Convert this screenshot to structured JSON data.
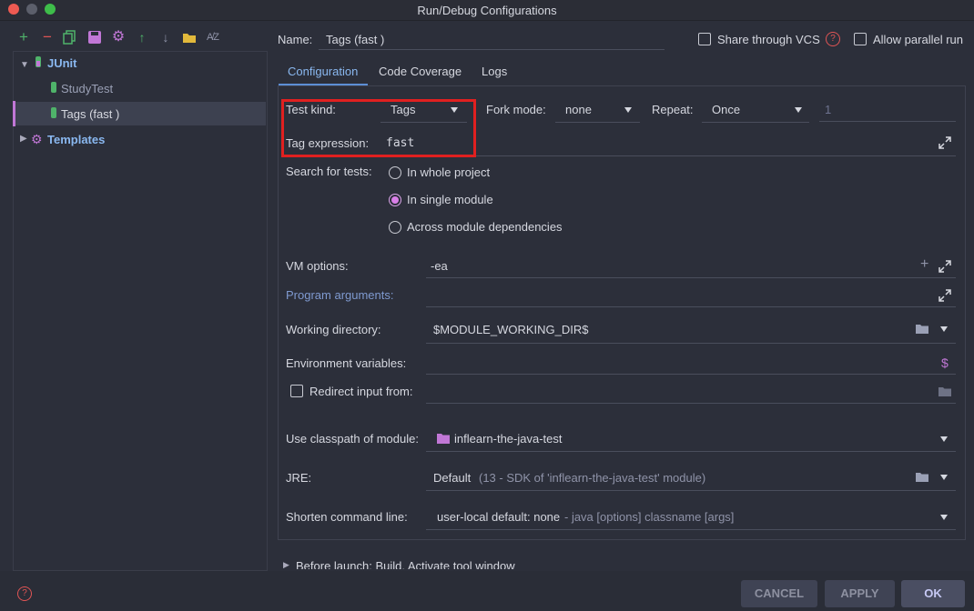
{
  "window": {
    "title": "Run/Debug Configurations"
  },
  "toolbar": {
    "icons": [
      "add-icon",
      "remove-icon",
      "copy-icon",
      "save-icon",
      "settings-icon",
      "move-up-icon",
      "move-down-icon",
      "folder-icon",
      "sort-icon"
    ]
  },
  "tree": {
    "root_label": "JUnit",
    "children": [
      "StudyTest",
      "Tags (fast )"
    ],
    "templates_label": "Templates"
  },
  "header": {
    "name_label": "Name:",
    "name_value": "Tags (fast )",
    "share_vcs_label": "Share through VCS",
    "allow_parallel_label": "Allow parallel run"
  },
  "tabs": [
    "Configuration",
    "Code Coverage",
    "Logs"
  ],
  "form": {
    "test_kind_label": "Test kind:",
    "test_kind_value": "Tags",
    "fork_mode_label": "Fork mode:",
    "fork_mode_value": "none",
    "repeat_label": "Repeat:",
    "repeat_value": "Once",
    "repeat_count": "1",
    "tag_expression_label": "Tag expression:",
    "tag_expression_value": "fast",
    "search_label": "Search for tests:",
    "search_options": [
      "In whole project",
      "In single module",
      "Across module dependencies"
    ],
    "vm_options_label": "VM options:",
    "vm_options_value": "-ea",
    "program_args_label": "Program arguments:",
    "working_dir_label": "Working directory:",
    "working_dir_value": "$MODULE_WORKING_DIR$",
    "env_vars_label": "Environment variables:",
    "redirect_label": "Redirect input from:",
    "classpath_label": "Use classpath of module:",
    "classpath_value": "inflearn-the-java-test",
    "jre_label": "JRE:",
    "jre_value": "Default",
    "jre_detail": "(13 - SDK of 'inflearn-the-java-test' module)",
    "shorten_label": "Shorten command line:",
    "shorten_value": "user-local default: none",
    "shorten_detail": "- java [options] classname [args]",
    "before_launch": "Before launch: Build, Activate tool window"
  },
  "buttons": {
    "cancel": "CANCEL",
    "apply": "APPLY",
    "ok": "OK"
  },
  "colors": {
    "highlight_box": "#e02020",
    "accent_tab": "#5d8fd6",
    "radio_selected": "#d97fe8"
  }
}
